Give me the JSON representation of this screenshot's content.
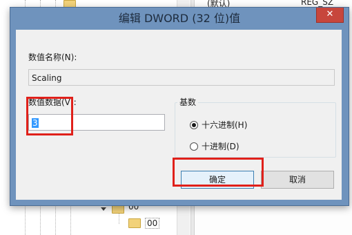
{
  "dialog": {
    "title": "编辑 DWORD (32 位)值",
    "close_glyph": "✕",
    "value_name_label": "数值名称(N):",
    "value_name": "Scaling",
    "value_data_label": "数值数据(V):",
    "value_data": "3",
    "base_label": "基数",
    "radio_hex": "十六进制(H)",
    "radio_dec": "十进制(D)",
    "selected_base": "hex",
    "ok_label": "确定",
    "cancel_label": "取消"
  },
  "background": {
    "tree_item_1": "00",
    "tree_item_2": "00",
    "list_item_name": "(默认)",
    "list_item_type": "REG_SZ"
  },
  "colors": {
    "highlight": "#e0201a",
    "title_bar": "#6f93bd",
    "close_button": "#c7463c"
  }
}
